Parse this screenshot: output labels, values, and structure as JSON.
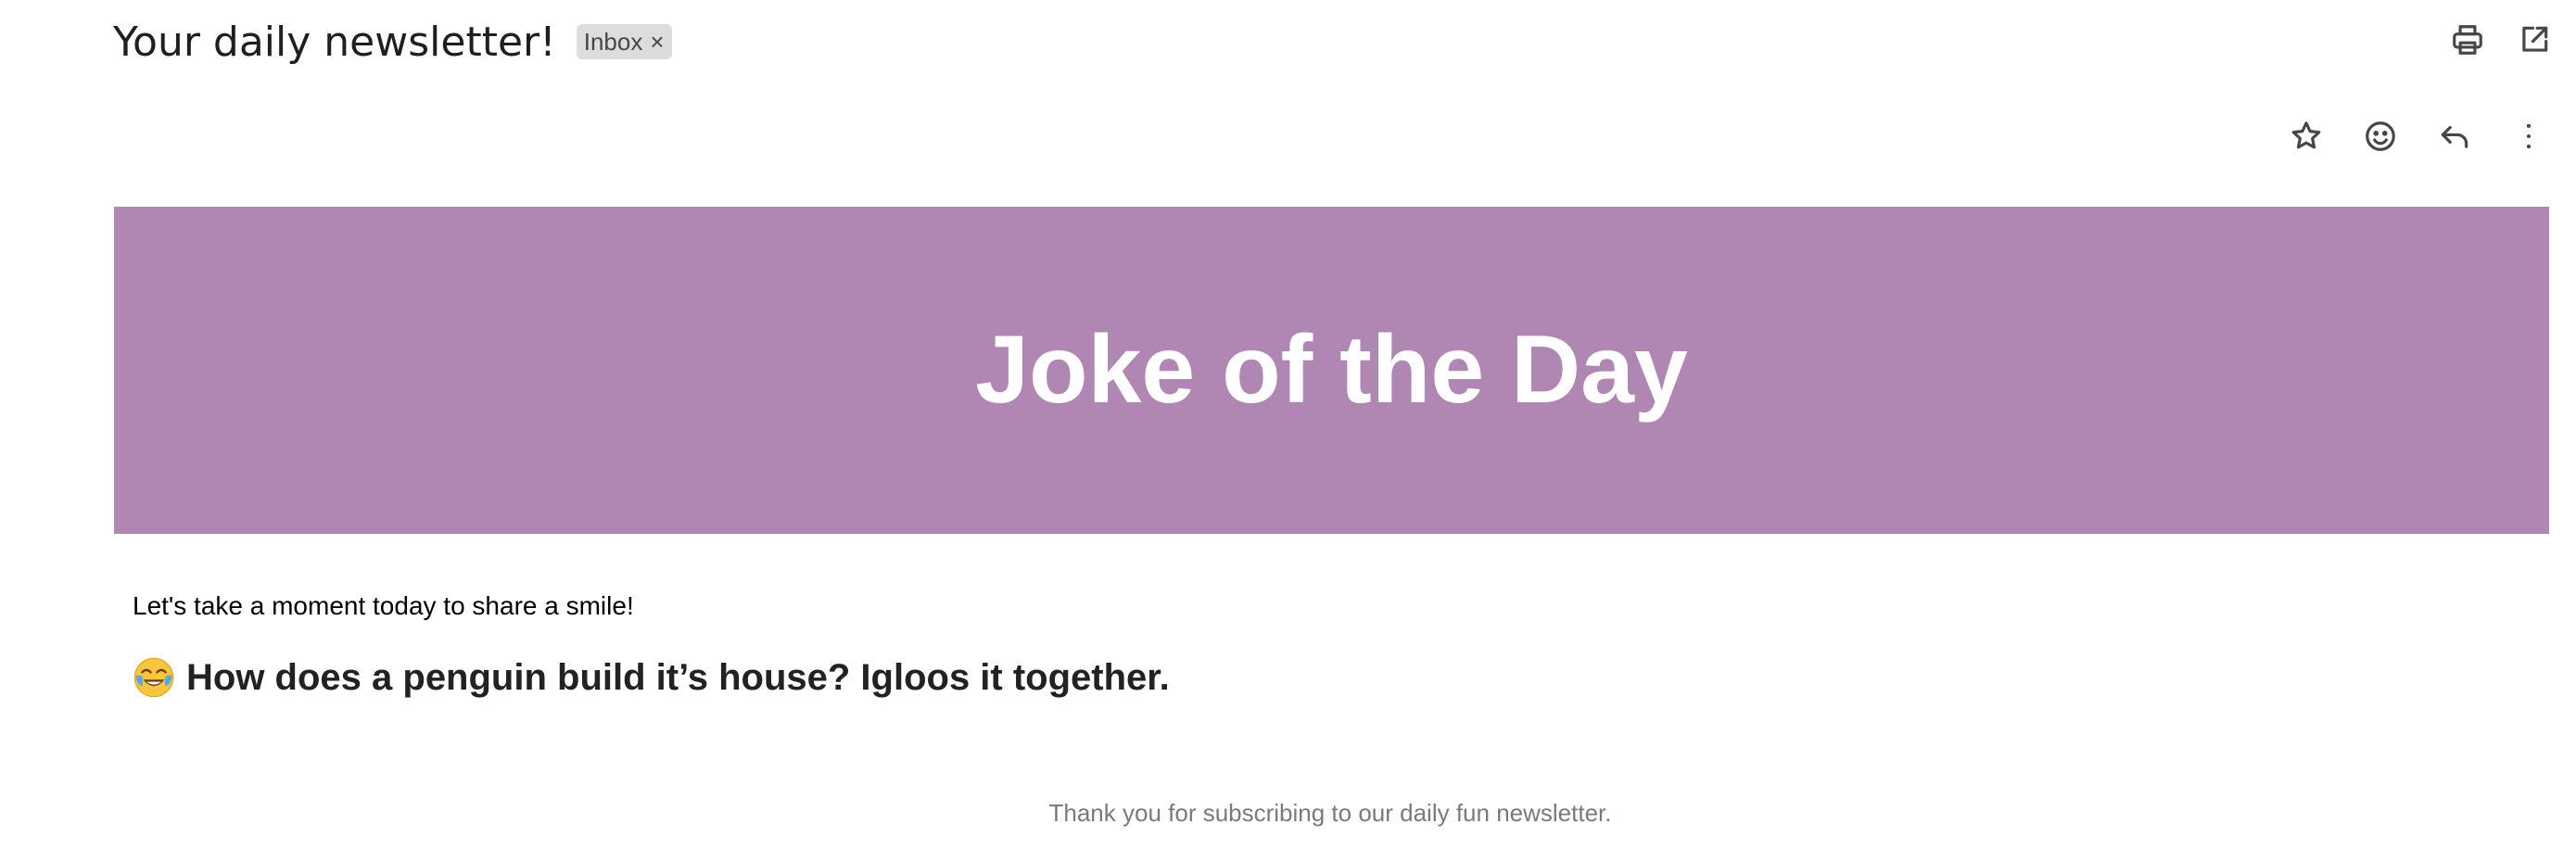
{
  "email": {
    "subject": "Your daily newsletter!",
    "label": "Inbox",
    "label_remove_symbol": "×"
  },
  "toolbar": {
    "top_icons": [
      "print-icon",
      "open-in-new-window-icon"
    ],
    "message_icons": [
      "star-icon",
      "emoji-reaction-icon",
      "reply-icon",
      "more-options-icon"
    ]
  },
  "newsletter": {
    "banner_title": "Joke of the Day",
    "banner_color": "#b087b3",
    "intro": "Let's take a moment today to share a smile!",
    "joke_emoji": "face-with-tears-of-joy-icon",
    "joke": "How does a penguin build it’s house? Igloos it together.",
    "footer": "Thank you for subscribing to our daily fun newsletter."
  }
}
